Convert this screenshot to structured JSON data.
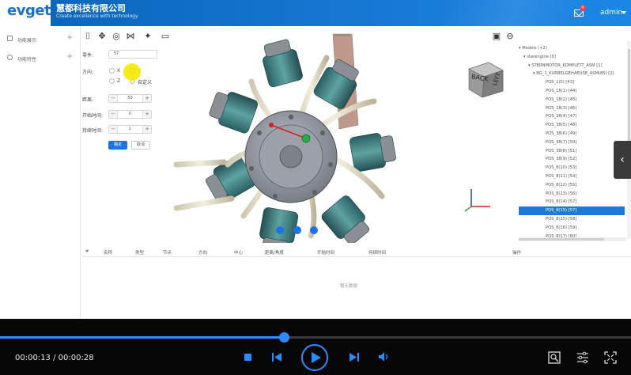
{
  "header": {
    "logo": "evget",
    "company_name": "慧都科技有限公司",
    "slogan": "Create excellence with technology",
    "user": "admin",
    "mail_badge": "0"
  },
  "sidebar": {
    "items": [
      {
        "label": "功能展示",
        "icon": "grid-icon"
      },
      {
        "label": "功能特性",
        "icon": "gear-icon"
      }
    ]
  },
  "toolbar": {
    "icons": [
      "camera-icon",
      "move-icon",
      "target-icon",
      "explode-icon",
      "sparkle-icon",
      "comment-icon"
    ],
    "right_icons": [
      "save-icon",
      "back-icon"
    ]
  },
  "form": {
    "part_label": "零件:",
    "part_value": "57",
    "direction_label": "方向:",
    "x": "X",
    "y": "Y",
    "z": "Z",
    "custom": "自定义",
    "distance_label": "距离:",
    "distance_value": "50",
    "start_label": "开始时间:",
    "start_value": "0",
    "duration_label": "持续时间:",
    "duration_value": "1",
    "confirm": "确定",
    "cancel": "取消"
  },
  "viewcube": {
    "back": "BACK",
    "left": "LEFT"
  },
  "tree": {
    "rows": [
      {
        "text": "▾ Models (+2)",
        "indent": 0,
        "selected": false
      },
      {
        "text": "▾ starengine [0]",
        "indent": 6,
        "selected": false
      },
      {
        "text": "▾ STERNMOTOR_KOMPLETT_ASM [1]",
        "indent": 12,
        "selected": false
      },
      {
        "text": "▾ BG_1_KURBELGEHAEUSE_ASM(85) [2]",
        "indent": 18,
        "selected": false
      },
      {
        "text": "POS_1(0) [43]",
        "indent": 34,
        "selected": false
      },
      {
        "text": "POS_18(1) [44]",
        "indent": 34,
        "selected": false
      },
      {
        "text": "POS_18(2) [45]",
        "indent": 34,
        "selected": false
      },
      {
        "text": "POS_18(3) [46]",
        "indent": 34,
        "selected": false
      },
      {
        "text": "POS_38(4) [47]",
        "indent": 34,
        "selected": false
      },
      {
        "text": "POS_38(5) [48]",
        "indent": 34,
        "selected": false
      },
      {
        "text": "POS_38(6) [49]",
        "indent": 34,
        "selected": false
      },
      {
        "text": "POS_38(7) [50]",
        "indent": 34,
        "selected": false
      },
      {
        "text": "POS_38(8) [51]",
        "indent": 34,
        "selected": false
      },
      {
        "text": "POS_38(9) [52]",
        "indent": 34,
        "selected": false
      },
      {
        "text": "POS_8(10) [53]",
        "indent": 34,
        "selected": false
      },
      {
        "text": "POS_8(11) [54]",
        "indent": 34,
        "selected": false
      },
      {
        "text": "POS_8(12) [55]",
        "indent": 34,
        "selected": false
      },
      {
        "text": "POS_8(13) [56]",
        "indent": 34,
        "selected": false
      },
      {
        "text": "POS_8(14) [57]",
        "indent": 34,
        "selected": false
      },
      {
        "text": "POS_8(15) [57]",
        "indent": 34,
        "selected": true
      },
      {
        "text": "POS_8(15) [58]",
        "indent": 34,
        "selected": false
      },
      {
        "text": "POS_8(16) [59]",
        "indent": 34,
        "selected": false
      },
      {
        "text": "POS_8(17) [60]",
        "indent": 34,
        "selected": false
      }
    ]
  },
  "table": {
    "headers": [
      "#",
      "名称",
      "类型",
      "节点",
      "方向",
      "中心",
      "距离/角度",
      "开始时间",
      "持续时间",
      "操作"
    ],
    "empty": "暂无数据"
  },
  "player": {
    "current": "00:00:13",
    "total": "00:00:28",
    "separator": " / ",
    "progress": 0.45,
    "accent": "#2c8cff"
  },
  "colors": {
    "header": "#1677d2",
    "selected": "#1e78d8"
  }
}
